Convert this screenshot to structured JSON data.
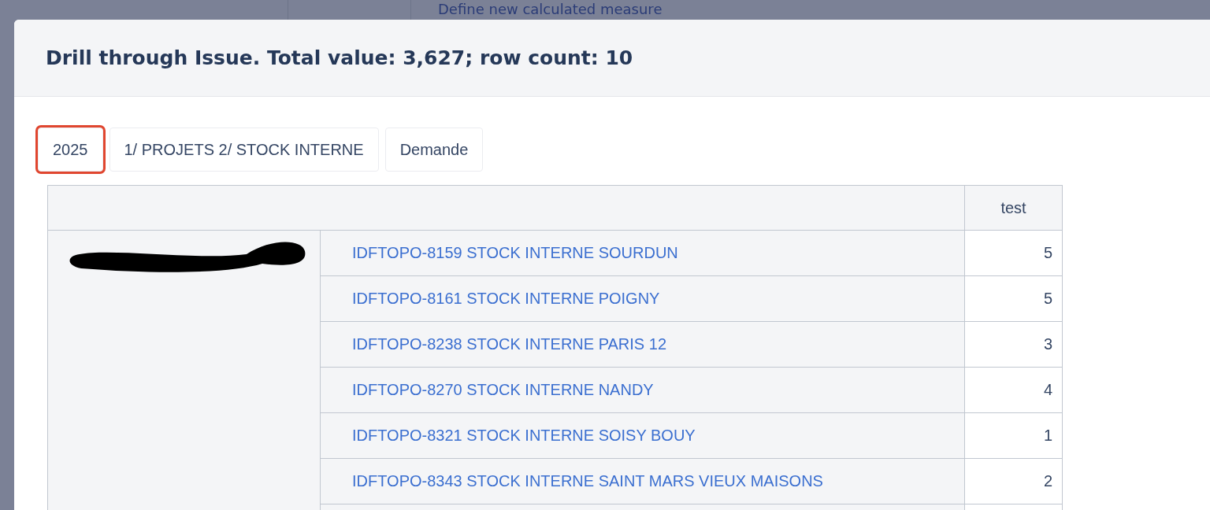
{
  "background": {
    "link": "Define new calculated measure"
  },
  "dialog": {
    "title": "Drill through Issue. Total value: 3,627; row count: 10",
    "chips": [
      {
        "label": "2025",
        "highlighted": true
      },
      {
        "label": "1/ PROJETS 2/ STOCK INTERNE",
        "highlighted": false
      },
      {
        "label": "Demande",
        "highlighted": false
      }
    ],
    "table": {
      "columns": [
        "test"
      ],
      "rows": [
        {
          "issue": "IDFTOPO-8159 STOCK INTERNE SOURDUN",
          "value": "5"
        },
        {
          "issue": "IDFTOPO-8161 STOCK INTERNE POIGNY",
          "value": "5"
        },
        {
          "issue": "IDFTOPO-8238 STOCK INTERNE PARIS 12",
          "value": "3"
        },
        {
          "issue": "IDFTOPO-8270 STOCK INTERNE NANDY",
          "value": "4"
        },
        {
          "issue": "IDFTOPO-8321 STOCK INTERNE SOISY BOUY",
          "value": "1"
        },
        {
          "issue": "IDFTOPO-8343 STOCK INTERNE SAINT MARS VIEUX MAISONS",
          "value": "2"
        }
      ]
    }
  }
}
